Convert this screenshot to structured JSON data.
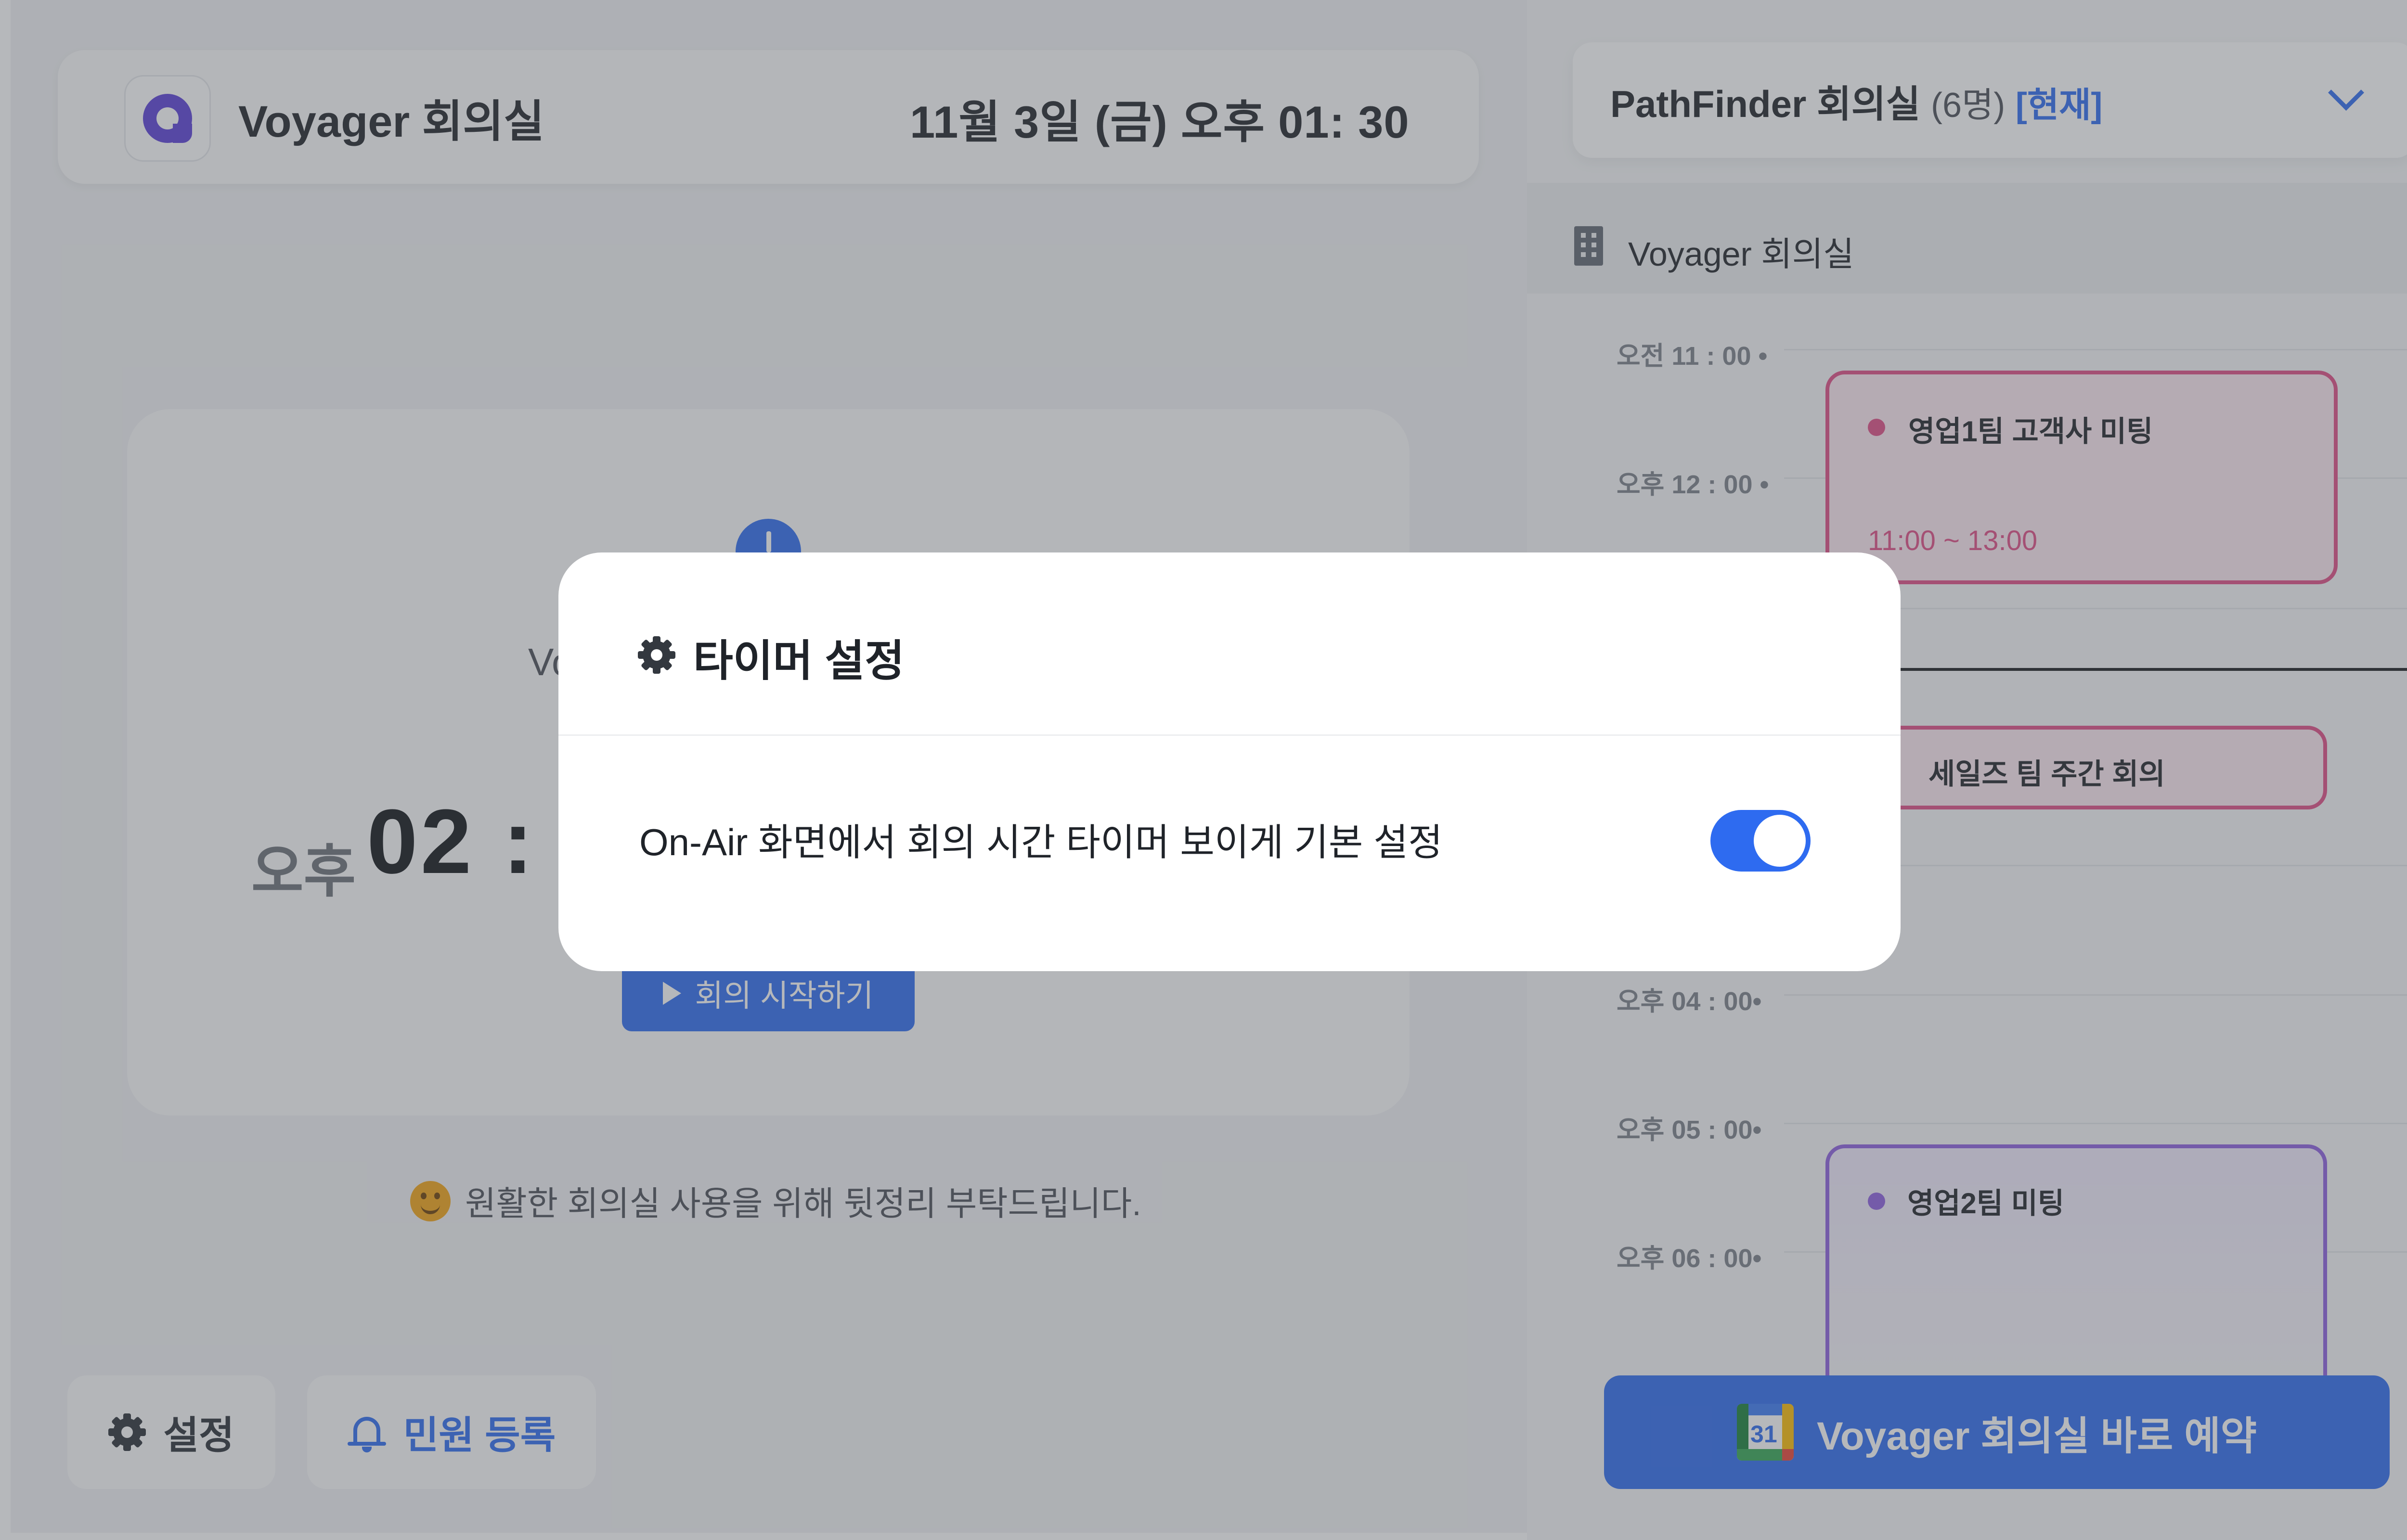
{
  "header": {
    "room_title": "Voyager 회의실",
    "datetime": "11월 3일 (금)  오후 01: 30"
  },
  "main": {
    "card_room": "Vo",
    "time_ampm": "오후",
    "time_big": "02 : 0",
    "start_button": "회의 시작하기",
    "notice": "원활한 회의실 사용을 위해 뒷정리 부탁드립니다."
  },
  "footer": {
    "settings_label": "설정",
    "complaint_label": "민원 등록"
  },
  "room_selector": {
    "name": "PathFinder 회의실",
    "count": "(6명)",
    "tag": "[현재]"
  },
  "schedule": {
    "room": "Voyager 회의실",
    "time_labels": [
      "오전 11 : 00  •",
      "오후 12 : 00  •",
      "오후 04 : 00•",
      "오후 05 : 00•",
      "오후 06 : 00•"
    ],
    "events": [
      {
        "title": "영업1팀 고객사 미팅",
        "time": "11:00 ~ 13:00",
        "color": "#e14d86"
      },
      {
        "title": "세일즈 팀 주간 회의",
        "color": "#e14d86"
      },
      {
        "title": "영업2팀 미팅",
        "color": "#8d5fe0"
      }
    ],
    "book_button": "Voyager 회의실 바로 예약",
    "calendar_day": "31"
  },
  "modal": {
    "title": "타이머 설정",
    "setting_label": "On-Air 화면에서 회의 시간 타이머 보이게 기본 설정",
    "toggle_on": true
  },
  "colors": {
    "accent": "#2e6bf0",
    "brand": "#5a3fd8"
  }
}
